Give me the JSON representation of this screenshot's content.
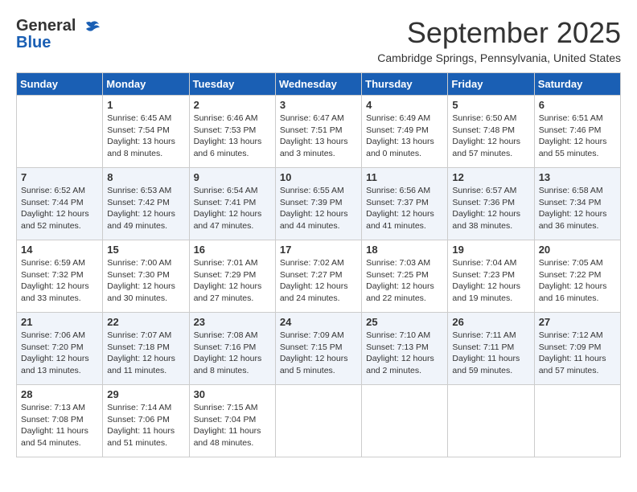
{
  "header": {
    "logo_line1": "General",
    "logo_line2": "Blue",
    "month": "September 2025",
    "location": "Cambridge Springs, Pennsylvania, United States"
  },
  "weekdays": [
    "Sunday",
    "Monday",
    "Tuesday",
    "Wednesday",
    "Thursday",
    "Friday",
    "Saturday"
  ],
  "weeks": [
    [
      {
        "day": "",
        "info": ""
      },
      {
        "day": "1",
        "info": "Sunrise: 6:45 AM\nSunset: 7:54 PM\nDaylight: 13 hours\nand 8 minutes."
      },
      {
        "day": "2",
        "info": "Sunrise: 6:46 AM\nSunset: 7:53 PM\nDaylight: 13 hours\nand 6 minutes."
      },
      {
        "day": "3",
        "info": "Sunrise: 6:47 AM\nSunset: 7:51 PM\nDaylight: 13 hours\nand 3 minutes."
      },
      {
        "day": "4",
        "info": "Sunrise: 6:49 AM\nSunset: 7:49 PM\nDaylight: 13 hours\nand 0 minutes."
      },
      {
        "day": "5",
        "info": "Sunrise: 6:50 AM\nSunset: 7:48 PM\nDaylight: 12 hours\nand 57 minutes."
      },
      {
        "day": "6",
        "info": "Sunrise: 6:51 AM\nSunset: 7:46 PM\nDaylight: 12 hours\nand 55 minutes."
      }
    ],
    [
      {
        "day": "7",
        "info": "Sunrise: 6:52 AM\nSunset: 7:44 PM\nDaylight: 12 hours\nand 52 minutes."
      },
      {
        "day": "8",
        "info": "Sunrise: 6:53 AM\nSunset: 7:42 PM\nDaylight: 12 hours\nand 49 minutes."
      },
      {
        "day": "9",
        "info": "Sunrise: 6:54 AM\nSunset: 7:41 PM\nDaylight: 12 hours\nand 47 minutes."
      },
      {
        "day": "10",
        "info": "Sunrise: 6:55 AM\nSunset: 7:39 PM\nDaylight: 12 hours\nand 44 minutes."
      },
      {
        "day": "11",
        "info": "Sunrise: 6:56 AM\nSunset: 7:37 PM\nDaylight: 12 hours\nand 41 minutes."
      },
      {
        "day": "12",
        "info": "Sunrise: 6:57 AM\nSunset: 7:36 PM\nDaylight: 12 hours\nand 38 minutes."
      },
      {
        "day": "13",
        "info": "Sunrise: 6:58 AM\nSunset: 7:34 PM\nDaylight: 12 hours\nand 36 minutes."
      }
    ],
    [
      {
        "day": "14",
        "info": "Sunrise: 6:59 AM\nSunset: 7:32 PM\nDaylight: 12 hours\nand 33 minutes."
      },
      {
        "day": "15",
        "info": "Sunrise: 7:00 AM\nSunset: 7:30 PM\nDaylight: 12 hours\nand 30 minutes."
      },
      {
        "day": "16",
        "info": "Sunrise: 7:01 AM\nSunset: 7:29 PM\nDaylight: 12 hours\nand 27 minutes."
      },
      {
        "day": "17",
        "info": "Sunrise: 7:02 AM\nSunset: 7:27 PM\nDaylight: 12 hours\nand 24 minutes."
      },
      {
        "day": "18",
        "info": "Sunrise: 7:03 AM\nSunset: 7:25 PM\nDaylight: 12 hours\nand 22 minutes."
      },
      {
        "day": "19",
        "info": "Sunrise: 7:04 AM\nSunset: 7:23 PM\nDaylight: 12 hours\nand 19 minutes."
      },
      {
        "day": "20",
        "info": "Sunrise: 7:05 AM\nSunset: 7:22 PM\nDaylight: 12 hours\nand 16 minutes."
      }
    ],
    [
      {
        "day": "21",
        "info": "Sunrise: 7:06 AM\nSunset: 7:20 PM\nDaylight: 12 hours\nand 13 minutes."
      },
      {
        "day": "22",
        "info": "Sunrise: 7:07 AM\nSunset: 7:18 PM\nDaylight: 12 hours\nand 11 minutes."
      },
      {
        "day": "23",
        "info": "Sunrise: 7:08 AM\nSunset: 7:16 PM\nDaylight: 12 hours\nand 8 minutes."
      },
      {
        "day": "24",
        "info": "Sunrise: 7:09 AM\nSunset: 7:15 PM\nDaylight: 12 hours\nand 5 minutes."
      },
      {
        "day": "25",
        "info": "Sunrise: 7:10 AM\nSunset: 7:13 PM\nDaylight: 12 hours\nand 2 minutes."
      },
      {
        "day": "26",
        "info": "Sunrise: 7:11 AM\nSunset: 7:11 PM\nDaylight: 11 hours\nand 59 minutes."
      },
      {
        "day": "27",
        "info": "Sunrise: 7:12 AM\nSunset: 7:09 PM\nDaylight: 11 hours\nand 57 minutes."
      }
    ],
    [
      {
        "day": "28",
        "info": "Sunrise: 7:13 AM\nSunset: 7:08 PM\nDaylight: 11 hours\nand 54 minutes."
      },
      {
        "day": "29",
        "info": "Sunrise: 7:14 AM\nSunset: 7:06 PM\nDaylight: 11 hours\nand 51 minutes."
      },
      {
        "day": "30",
        "info": "Sunrise: 7:15 AM\nSunset: 7:04 PM\nDaylight: 11 hours\nand 48 minutes."
      },
      {
        "day": "",
        "info": ""
      },
      {
        "day": "",
        "info": ""
      },
      {
        "day": "",
        "info": ""
      },
      {
        "day": "",
        "info": ""
      }
    ]
  ]
}
